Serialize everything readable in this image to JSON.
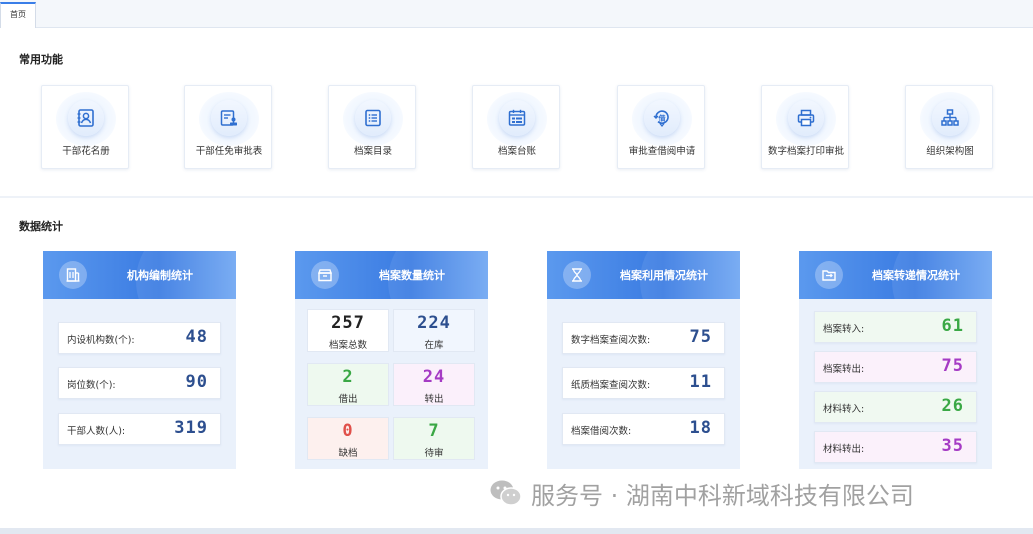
{
  "tabs": [
    {
      "label": "首页"
    }
  ],
  "sections": {
    "common_functions": "常用功能",
    "data_statistics": "数据统计"
  },
  "functions": [
    {
      "label": "干部花名册",
      "icon": "roster-icon"
    },
    {
      "label": "干部任免审批表",
      "icon": "appointment-form-icon"
    },
    {
      "label": "档案目录",
      "icon": "list-icon"
    },
    {
      "label": "档案台账",
      "icon": "ledger-icon"
    },
    {
      "label": "审批查借阅申请",
      "icon": "borrow-approval-icon"
    },
    {
      "label": "数字档案打印审批",
      "icon": "printer-icon"
    },
    {
      "label": "组织架构图",
      "icon": "org-chart-icon"
    }
  ],
  "stats": {
    "org": {
      "title": "机构编制统计",
      "icon": "building-icon",
      "rows": [
        {
          "label": "内设机构数(个):",
          "value": "48"
        },
        {
          "label": "岗位数(个):",
          "value": "90"
        },
        {
          "label": "干部人数(人):",
          "value": "319"
        }
      ]
    },
    "archive": {
      "title": "档案数量统计",
      "icon": "archive-box-icon",
      "tiles": [
        {
          "value": "257",
          "label": "档案总数"
        },
        {
          "value": "224",
          "label": "在库"
        },
        {
          "value": "2",
          "label": "借出"
        },
        {
          "value": "24",
          "label": "转出"
        },
        {
          "value": "0",
          "label": "缺档"
        },
        {
          "value": "7",
          "label": "待审"
        }
      ]
    },
    "usage": {
      "title": "档案利用情况统计",
      "icon": "hourglass-icon",
      "rows": [
        {
          "label": "数字档案查阅次数:",
          "value": "75"
        },
        {
          "label": "纸质档案查阅次数:",
          "value": "11"
        },
        {
          "label": "档案借阅次数:",
          "value": "18"
        }
      ]
    },
    "transfer": {
      "title": "档案转递情况统计",
      "icon": "transfer-folder-icon",
      "rows": [
        {
          "label": "档案转入:",
          "value": "61"
        },
        {
          "label": "档案转出:",
          "value": "75"
        },
        {
          "label": "材料转入:",
          "value": "26"
        },
        {
          "label": "材料转出:",
          "value": "35"
        }
      ]
    }
  },
  "colors": {
    "accent": "#3a7be2",
    "value_blue": "#2d4f8f",
    "value_green": "#3aa845",
    "value_purple": "#a53bc4",
    "value_red": "#e0504a",
    "value_black": "#222222"
  },
  "watermark": {
    "text": "服务号 · 湖南中科新域科技有限公司",
    "icon": "wechat-icon"
  }
}
